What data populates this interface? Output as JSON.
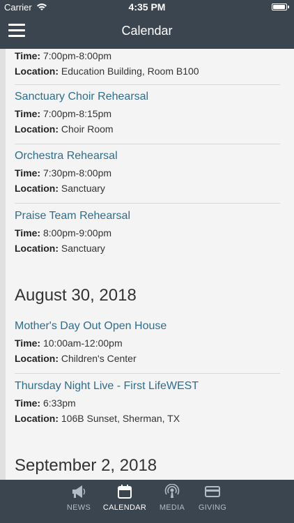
{
  "status": {
    "carrier": "Carrier",
    "time": "4:35 PM"
  },
  "nav": {
    "title": "Calendar"
  },
  "partial_event": {
    "time": "7:00pm-8:00pm",
    "location": "Education Building, Room B100"
  },
  "sections": [
    {
      "date": "",
      "events": [
        {
          "title": "Sanctuary Choir Rehearsal",
          "time": "7:00pm-8:15pm",
          "location": "Choir Room"
        },
        {
          "title": "Orchestra Rehearsal",
          "time": "7:30pm-8:00pm",
          "location": "Sanctuary"
        },
        {
          "title": "Praise Team Rehearsal",
          "time": "8:00pm-9:00pm",
          "location": "Sanctuary"
        }
      ]
    },
    {
      "date": "August 30, 2018",
      "events": [
        {
          "title": "Mother's Day Out Open House",
          "time": "10:00am-12:00pm",
          "location": "Children's Center"
        },
        {
          "title": "Thursday Night Live - First LifeWEST",
          "time": "6:33pm",
          "location": "106B Sunset, Sherman, TX"
        }
      ]
    },
    {
      "date": "September 2, 2018",
      "events": []
    }
  ],
  "labels": {
    "time": "Time:",
    "location": "Location:"
  },
  "tabs": [
    {
      "label": "NEWS",
      "icon": "megaphone-icon",
      "active": false
    },
    {
      "label": "CALENDAR",
      "icon": "calendar-icon",
      "active": true
    },
    {
      "label": "MEDIA",
      "icon": "podcast-icon",
      "active": false
    },
    {
      "label": "GIVING",
      "icon": "credit-card-icon",
      "active": false
    }
  ],
  "colors": {
    "bar": "#3a4550",
    "link": "#2d6e8e",
    "background": "#f4f4f4"
  }
}
